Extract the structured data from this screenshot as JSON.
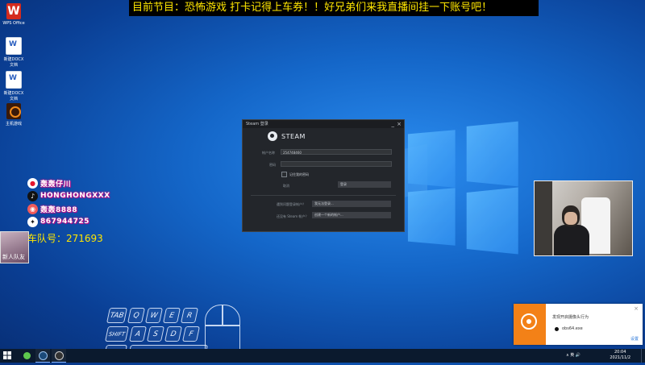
{
  "ticker": {
    "text": "目前节目：恐怖游戏       打卡记得上车券！！好兄弟们来我直播间挂一下账号吧！"
  },
  "desktop_icons": [
    {
      "label": "WPS Office",
      "icon": "wps-office-icon"
    },
    {
      "label": "新建DOCX 文档",
      "icon": "word-document-icon"
    },
    {
      "label": "新建DOCX 文档",
      "icon": "word-document-icon"
    },
    {
      "label": "主机游戏",
      "icon": "game-app-icon"
    }
  ],
  "social": [
    {
      "icon": "weibo-icon",
      "handle": "轰轰仔川"
    },
    {
      "icon": "douyin-icon",
      "handle": "HONGHONGXXX"
    },
    {
      "icon": "app-icon",
      "handle": "轰轰8888"
    },
    {
      "icon": "qq-icon",
      "handle": "867944725"
    }
  ],
  "team": {
    "label": "车队号：271693",
    "thumb_label": "新人队友"
  },
  "steam_dialog": {
    "window_title": "Steam 登录",
    "brand": "STEAM",
    "account_label": "帐户名称",
    "account_value": "254748460",
    "password_label": "密码",
    "password_value": "",
    "remember_label": "记住我的密码",
    "cancel_label": "取消",
    "login_label": "登录",
    "help_question": "遇到问题登录帐户？",
    "help_button": "我无法登录...",
    "create_question": "还没有 Steam 帐户？",
    "create_button": "创建一个新的帐户...",
    "minimize": "_",
    "close": "×"
  },
  "keyboard_overlay": {
    "row1": [
      "TAB",
      "Q",
      "W",
      "E",
      "R"
    ],
    "row2": [
      "SHIFT",
      "A",
      "S",
      "D",
      "F"
    ],
    "row3": [
      "CTRL",
      ""
    ]
  },
  "notification": {
    "title": "发现开启摄像头行为",
    "device_name": "obs64.exe",
    "action": "设置",
    "close": "×"
  },
  "taskbar": {
    "tray_text": "∧  英  🔊",
    "time": "20:04",
    "date": "2021/11/2"
  },
  "colors": {
    "ticker_text": "#ffe600",
    "steam_bg": "#23262b",
    "notif_accent": "#f38117",
    "taskbar": "#0b1a2e"
  }
}
